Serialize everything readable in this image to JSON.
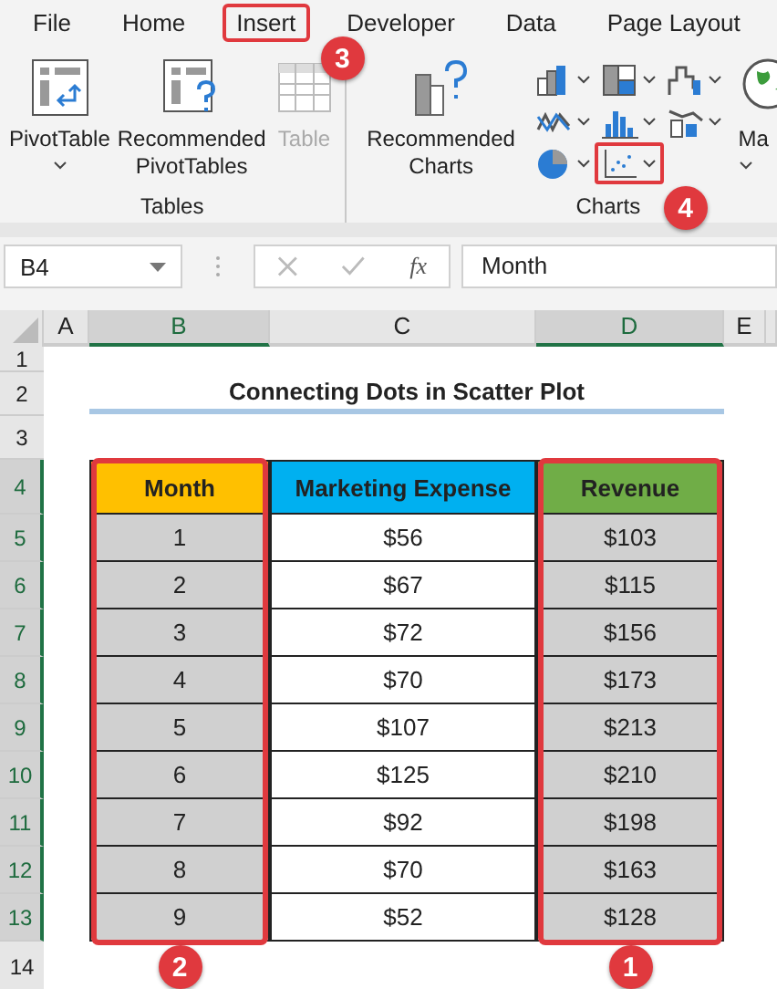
{
  "menu_tabs": [
    {
      "label": "File",
      "selected": false
    },
    {
      "label": "Home",
      "selected": false
    },
    {
      "label": "Insert",
      "selected": true,
      "callout": "3"
    },
    {
      "label": "Developer",
      "selected": false
    },
    {
      "label": "Data",
      "selected": false
    },
    {
      "label": "Page Layout",
      "selected": false
    }
  ],
  "ribbon": {
    "tables": {
      "label": "Tables",
      "buttons": [
        {
          "kind": "pivot",
          "label": "PivotTable",
          "dropdown": true,
          "disabled": false
        },
        {
          "kind": "recommended-pivot",
          "label": "Recommended PivotTables",
          "dropdown": false,
          "disabled": false
        },
        {
          "kind": "table",
          "label": "Table",
          "dropdown": false,
          "disabled": true
        }
      ]
    },
    "charts": {
      "label": "Charts",
      "recommended": "Recommended Charts",
      "chart_buttons": [
        {
          "kind": "column",
          "outlined": false
        },
        {
          "kind": "treemap",
          "outlined": false
        },
        {
          "kind": "waterfall",
          "outlined": false
        },
        {
          "kind": "line",
          "outlined": false
        },
        {
          "kind": "histogram",
          "outlined": false
        },
        {
          "kind": "combo",
          "outlined": false
        },
        {
          "kind": "pie",
          "outlined": false
        },
        {
          "kind": "scatter",
          "outlined": true,
          "callout": "4"
        }
      ],
      "maps": {
        "label": "Ma"
      }
    }
  },
  "formula_bar": {
    "name_box": "B4",
    "fx": "fx",
    "formula": "Month"
  },
  "columns": [
    {
      "label": "A",
      "selected": false
    },
    {
      "label": "B",
      "selected": true
    },
    {
      "label": "C",
      "selected": false
    },
    {
      "label": "D",
      "selected": true
    },
    {
      "label": "E",
      "selected": false
    }
  ],
  "rows": [
    {
      "label": "1",
      "selected": false
    },
    {
      "label": "2",
      "selected": false
    },
    {
      "label": "3",
      "selected": false
    },
    {
      "label": "4",
      "selected": true
    },
    {
      "label": "5",
      "selected": true
    },
    {
      "label": "6",
      "selected": true
    },
    {
      "label": "7",
      "selected": true
    },
    {
      "label": "8",
      "selected": true
    },
    {
      "label": "9",
      "selected": true
    },
    {
      "label": "10",
      "selected": true
    },
    {
      "label": "11",
      "selected": true
    },
    {
      "label": "12",
      "selected": true
    },
    {
      "label": "13",
      "selected": true
    },
    {
      "label": "14",
      "selected": false
    }
  ],
  "title": "Connecting Dots in Scatter Plot",
  "table": [
    {
      "header": "Month",
      "color": "#ffc000",
      "selected": true,
      "outlined": true,
      "callout": "2",
      "cells": [
        "1",
        "2",
        "3",
        "4",
        "5",
        "6",
        "7",
        "8",
        "9"
      ]
    },
    {
      "header": "Marketing Expense",
      "color": "#00b0f0",
      "selected": false,
      "outlined": false,
      "cells": [
        "$56",
        "$67",
        "$72",
        "$70",
        "$107",
        "$125",
        "$92",
        "$70",
        "$52"
      ]
    },
    {
      "header": "Revenue",
      "color": "#70ad47",
      "selected": true,
      "outlined": true,
      "callout": "1",
      "cells": [
        "$103",
        "$115",
        "$156",
        "$173",
        "$213",
        "$210",
        "$198",
        "$163",
        "$128"
      ]
    }
  ]
}
